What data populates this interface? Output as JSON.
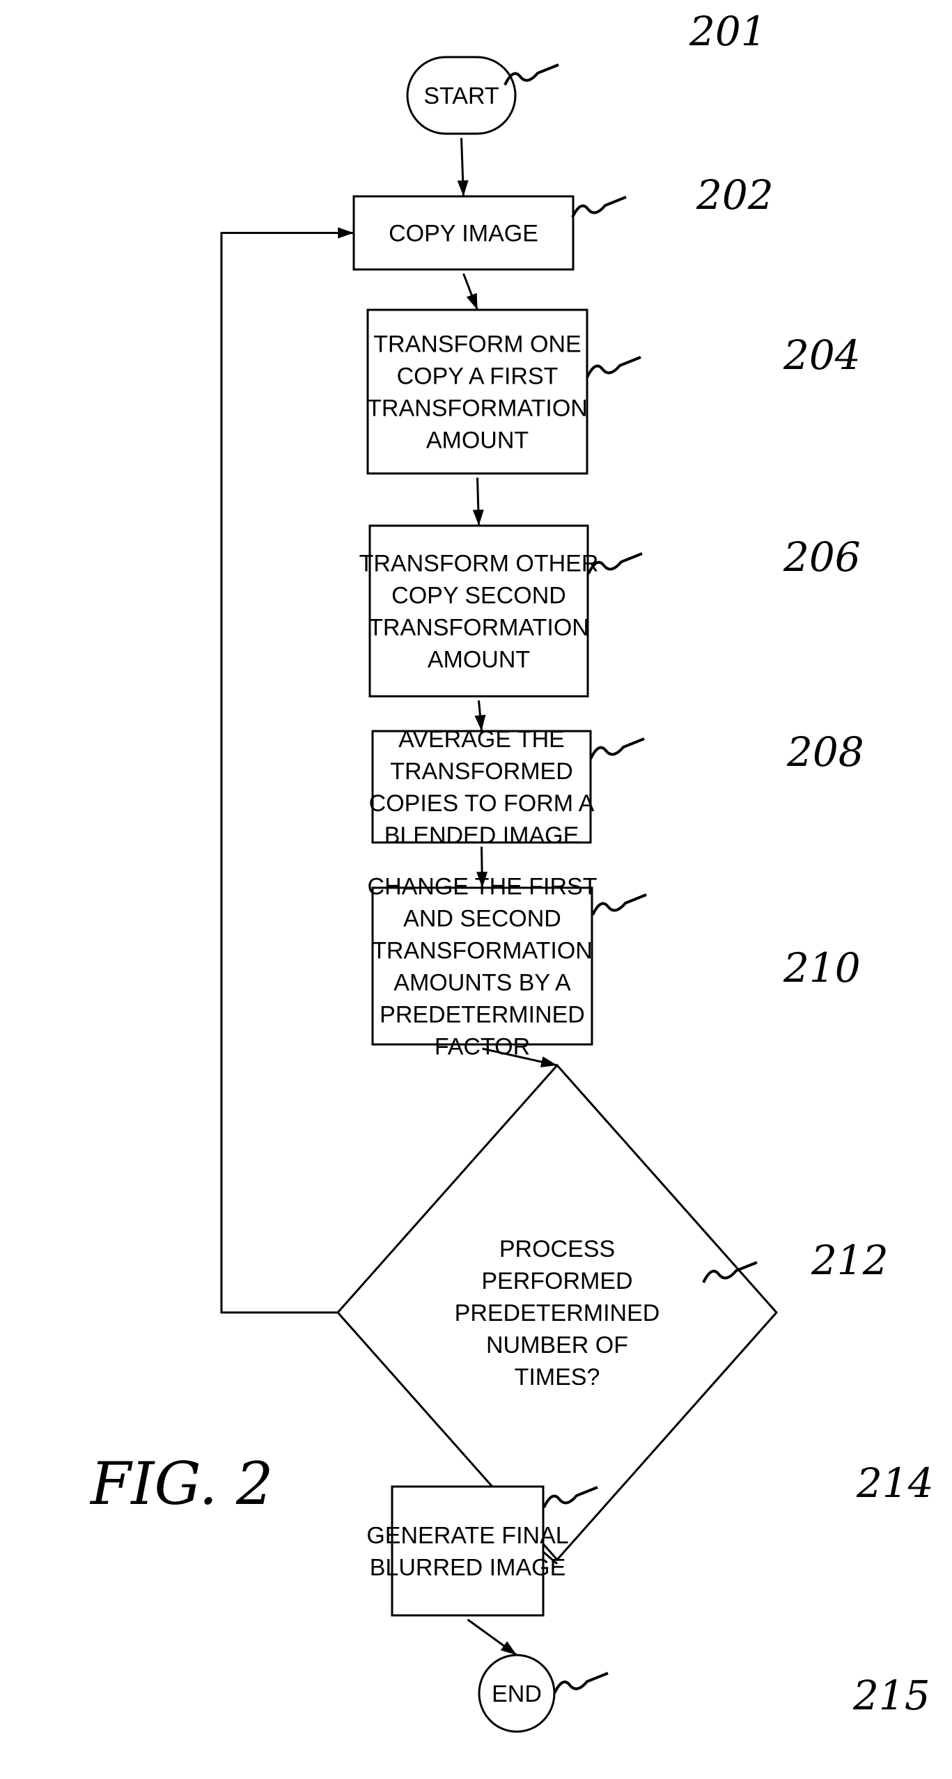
{
  "figure_label": "FIG. 2",
  "nodes": [
    {
      "id": "201",
      "type": "terminal",
      "ref": "201",
      "lines": [
        "START"
      ]
    },
    {
      "id": "202",
      "type": "process",
      "ref": "202",
      "lines": [
        "COPY IMAGE"
      ]
    },
    {
      "id": "204",
      "type": "process",
      "ref": "204",
      "lines": [
        "TRANSFORM ONE",
        "COPY A FIRST",
        "TRANSFORMATION",
        "AMOUNT"
      ]
    },
    {
      "id": "206",
      "type": "process",
      "ref": "206",
      "lines": [
        "TRANSFORM OTHER",
        "COPY SECOND",
        "TRANSFORMATION",
        "AMOUNT"
      ]
    },
    {
      "id": "208",
      "type": "process",
      "ref": "208",
      "lines": [
        "AVERAGE THE",
        "TRANSFORMED",
        "COPIES TO FORM A",
        "BLENDED IMAGE"
      ]
    },
    {
      "id": "210",
      "type": "process",
      "ref": "210",
      "lines": [
        "CHANGE THE FIRST",
        "AND SECOND",
        "TRANSFORMATION",
        "AMOUNTS BY A",
        "PREDETERMINED",
        "FACTOR"
      ]
    },
    {
      "id": "212",
      "type": "decision",
      "ref": "212",
      "lines": [
        "PROCESS",
        "PERFORMED",
        "PREDETERMINED",
        "NUMBER OF",
        "TIMES?"
      ]
    },
    {
      "id": "214",
      "type": "process",
      "ref": "214",
      "lines": [
        "GENERATE FINAL",
        "BLURRED IMAGE"
      ]
    },
    {
      "id": "215",
      "type": "terminal",
      "ref": "215",
      "lines": [
        "END"
      ]
    }
  ],
  "edges": [
    {
      "from": "201",
      "to": "202"
    },
    {
      "from": "202",
      "to": "204"
    },
    {
      "from": "204",
      "to": "206"
    },
    {
      "from": "206",
      "to": "208"
    },
    {
      "from": "208",
      "to": "210"
    },
    {
      "from": "210",
      "to": "212"
    },
    {
      "from": "212",
      "to": "202",
      "kind": "loop-back"
    },
    {
      "from": "212",
      "to": "214"
    },
    {
      "from": "214",
      "to": "215"
    }
  ]
}
